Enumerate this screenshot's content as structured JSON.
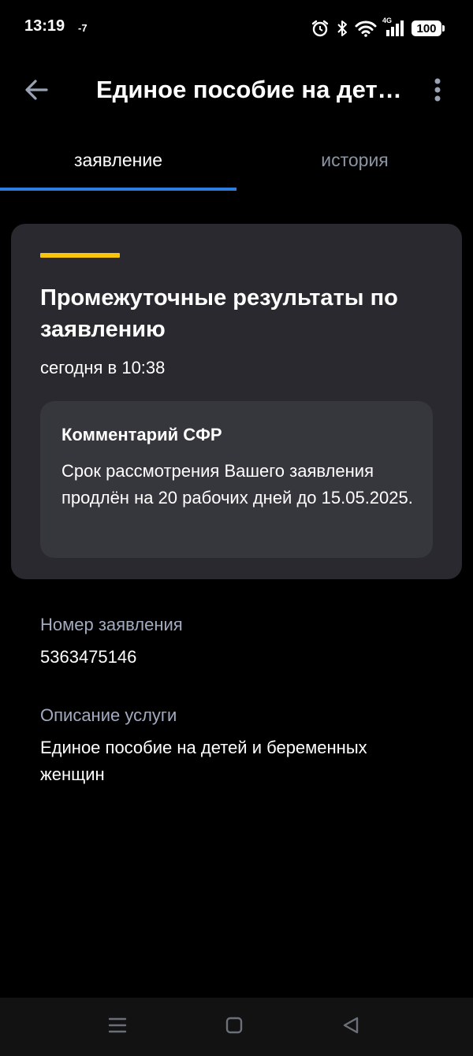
{
  "status_bar": {
    "time": "13:19",
    "temperature": "-7",
    "network": "4G",
    "battery": "100"
  },
  "app_bar": {
    "title": "Единое пособие на дет…",
    "back_icon": "arrow-left-icon",
    "more_icon": "more-vertical-icon"
  },
  "tabs": [
    {
      "label": "заявление",
      "active": true
    },
    {
      "label": "история",
      "active": false
    }
  ],
  "status_card": {
    "accent_color": "#f7c50a",
    "title": "Промежуточные результаты по заявлению",
    "date": "сегодня в 10:38",
    "comment": {
      "title": "Комментарий СФР",
      "text": "Срок рассмотрения Вашего заявления продлён на 20 рабочих дней до 15.05.2025."
    }
  },
  "details": {
    "application_number": {
      "label": "Номер заявления",
      "value": "5363475146"
    },
    "service_description": {
      "label": "Описание услуги",
      "value": "Единое пособие на детей и беременных женщин"
    }
  },
  "nav_bar": {
    "icons": [
      "menu-icon",
      "home-square-icon",
      "back-triangle-icon"
    ]
  },
  "colors": {
    "background": "#000000",
    "card": "#29292f",
    "comment_box": "#36363d",
    "tab_indicator": "#2e7de0",
    "muted_text": "#a3abc0"
  }
}
